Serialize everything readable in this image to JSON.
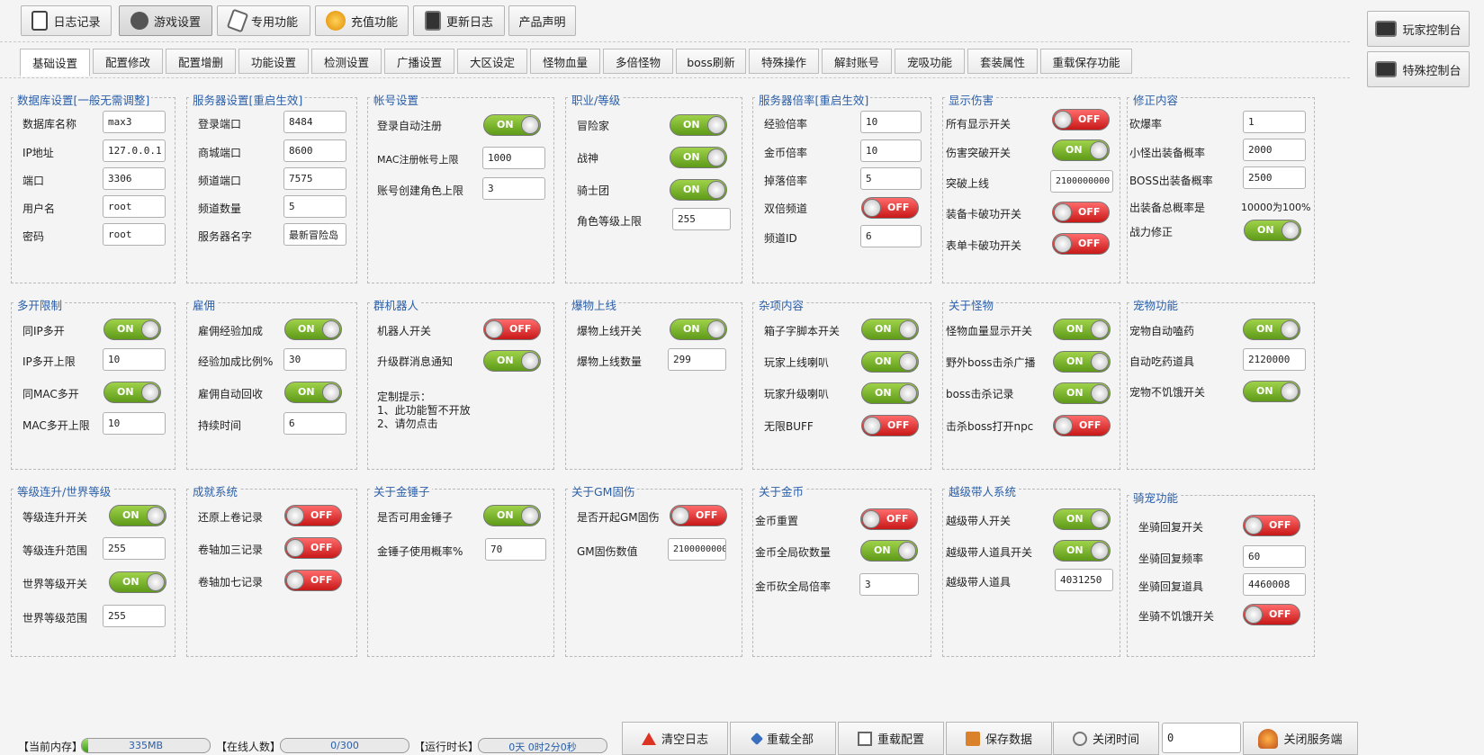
{
  "toolbar": {
    "buttons": [
      "日志记录",
      "游戏设置",
      "专用功能",
      "充值功能",
      "更新日志",
      "产品声明"
    ]
  },
  "side": {
    "player_console": "玩家控制台",
    "special_console": "特殊控制台"
  },
  "tabs": [
    "基础设置",
    "配置修改",
    "配置增删",
    "功能设置",
    "检测设置",
    "广播设置",
    "大区设定",
    "怪物血量",
    "多倍怪物",
    "boss刷新",
    "特殊操作",
    "解封账号",
    "宠吸功能",
    "套装属性",
    "重载保存功能"
  ],
  "db": {
    "title": "数据库设置[一般无需调整]",
    "name_l": "数据库名称",
    "name_v": "max3",
    "ip_l": "IP地址",
    "ip_v": "127.0.0.1",
    "port_l": "端口",
    "port_v": "3306",
    "user_l": "用户名",
    "user_v": "root",
    "pwd_l": "密码",
    "pwd_v": "root"
  },
  "srv": {
    "title": "服务器设置[重启生效]",
    "login_l": "登录端口",
    "login_v": "8484",
    "shop_l": "商城端口",
    "shop_v": "8600",
    "chan_l": "频道端口",
    "chan_v": "7575",
    "cnum_l": "频道数量",
    "cnum_v": "5",
    "sname_l": "服务器名字",
    "sname_v": "最新冒险岛"
  },
  "acct": {
    "title": "帐号设置",
    "auto_l": "登录自动注册",
    "auto_s": "ON",
    "mac_l": "MAC注册帐号上限",
    "mac_v": "1000",
    "char_l": "账号创建角色上限",
    "char_v": "3"
  },
  "job": {
    "title": "职业/等级",
    "a_l": "冒险家",
    "a_s": "ON",
    "b_l": "战神",
    "b_s": "ON",
    "c_l": "骑士团",
    "c_s": "ON",
    "lv_l": "角色等级上限",
    "lv_v": "255"
  },
  "rate": {
    "title": "服务器倍率[重启生效]",
    "exp_l": "经验倍率",
    "exp_v": "10",
    "meso_l": "金币倍率",
    "meso_v": "10",
    "drop_l": "掉落倍率",
    "drop_v": "5",
    "dbl_l": "双倍频道",
    "dbl_s": "OFF",
    "cid_l": "频道ID",
    "cid_v": "6"
  },
  "dmg": {
    "title": "显示伤害",
    "all_l": "所有显示开关",
    "all_s": "OFF",
    "brk_l": "伤害突破开关",
    "brk_s": "ON",
    "lim_l": "突破上线",
    "lim_v": "2100000000",
    "eq_l": "装备卡破功开关",
    "eq_s": "OFF",
    "tb_l": "表单卡破功开关",
    "tb_s": "OFF"
  },
  "fix": {
    "title": "修正内容",
    "cut_l": "砍爆率",
    "cut_v": "1",
    "small_l": "小怪出装备概率",
    "small_v": "2000",
    "boss_l": "BOSS出装备概率",
    "boss_v": "2500",
    "total_l": "出装备总概率是",
    "total_v": "10000为100%",
    "pow_l": "战力修正",
    "pow_s": "ON"
  },
  "multi": {
    "title": "多开限制",
    "ip_l": "同IP多开",
    "ip_s": "ON",
    "iplim_l": "IP多开上限",
    "iplim_v": "10",
    "mac_l": "同MAC多开",
    "mac_s": "ON",
    "maclim_l": "MAC多开上限",
    "maclim_v": "10"
  },
  "hire": {
    "title": "雇佣",
    "exp_l": "雇佣经验加成",
    "exp_s": "ON",
    "pct_l": "经验加成比例%",
    "pct_v": "30",
    "rec_l": "雇佣自动回收",
    "rec_s": "ON",
    "dur_l": "持续时间",
    "dur_v": "6"
  },
  "bot": {
    "title": "群机器人",
    "sw_l": "机器人开关",
    "sw_s": "OFF",
    "up_l": "升级群消息通知",
    "up_s": "ON",
    "note1": "定制提示：",
    "note2": "1、此功能暂不开放",
    "note3": "2、请勿点击"
  },
  "blast": {
    "title": "爆物上线",
    "sw_l": "爆物上线开关",
    "sw_s": "ON",
    "num_l": "爆物上线数量",
    "num_v": "299"
  },
  "misc": {
    "title": "杂项内容",
    "box_l": "箱子字脚本开关",
    "box_s": "ON",
    "on_l": "玩家上线喇叭",
    "on_s": "ON",
    "lvup_l": "玩家升级喇叭",
    "lvup_s": "ON",
    "buff_l": "无限BUFF",
    "buff_s": "OFF"
  },
  "mob": {
    "title": "关于怪物",
    "hp_l": "怪物血量显示开关",
    "hp_s": "ON",
    "kill_l": "野外boss击杀广播",
    "kill_s": "ON",
    "rec_l": "boss击杀记录",
    "rec_s": "ON",
    "npc_l": "击杀boss打开npc",
    "npc_s": "OFF"
  },
  "pet": {
    "title": "宠物功能",
    "pot_l": "宠物自动嗑药",
    "pot_s": "ON",
    "item_l": "自动吃药道具",
    "item_v": "2120000",
    "hun_l": "宠物不饥饿开关",
    "hun_s": "ON"
  },
  "lvl": {
    "title": "等级连升/世界等级",
    "up_l": "等级连升开关",
    "up_s": "ON",
    "upr_l": "等级连升范围",
    "upr_v": "255",
    "w_l": "世界等级开关",
    "w_s": "ON",
    "wr_l": "世界等级范围",
    "wr_v": "255"
  },
  "ach": {
    "title": "成就系统",
    "a_l": "还原上卷记录",
    "a_s": "OFF",
    "b_l": "卷轴加三记录",
    "b_s": "OFF",
    "c_l": "卷轴加七记录",
    "c_s": "OFF"
  },
  "ham": {
    "title": "关于金锤子",
    "use_l": "是否可用金锤子",
    "use_s": "ON",
    "rate_l": "金锤子使用概率%",
    "rate_v": "70"
  },
  "gm": {
    "title": "关于GM固伤",
    "sw_l": "是否开起GM固伤",
    "sw_s": "OFF",
    "val_l": "GM固伤数值",
    "val_v": "2100000000"
  },
  "gold": {
    "title": "关于金币",
    "reset_l": "金币重置",
    "reset_s": "OFF",
    "cut_l": "金币全局砍数量",
    "cut_s": "ON",
    "rate_l": "金币砍全局倍率",
    "rate_v": "3"
  },
  "carry": {
    "title": "越级带人系统",
    "sw_l": "越级带人开关",
    "sw_s": "ON",
    "item_sw_l": "越级带人道具开关",
    "item_sw_s": "ON",
    "item_l": "越级带人道具",
    "item_v": "4031250"
  },
  "mount": {
    "title": "骑宠功能",
    "rec_l": "坐骑回复开关",
    "rec_s": "OFF",
    "freq_l": "坐骑回复频率",
    "freq_v": "60",
    "item_l": "坐骑回复道具",
    "item_v": "4460008",
    "hun_l": "坐骑不饥饿开关",
    "hun_s": "OFF"
  },
  "status": {
    "mem_l": "【当前内存】",
    "mem_v": "335MB",
    "mem_frac": 0.05,
    "online_l": "【在线人数】",
    "online_v": "0/300",
    "online_frac": 0,
    "run_l": "【运行时长】",
    "run_v": "0天 0时2分0秒"
  },
  "bottom": {
    "clear": "清空日志",
    "reload_all": "重载全部",
    "reload_cfg": "重载配置",
    "save": "保存数据",
    "close_time": "关闭时间",
    "time_v": "0",
    "shutdown": "关闭服务端"
  }
}
